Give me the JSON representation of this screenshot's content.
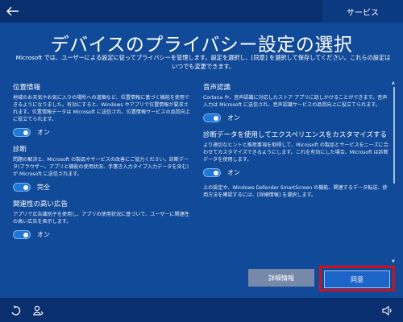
{
  "topbar": {
    "back_icon": "arrow-left-icon",
    "label": "サービス"
  },
  "title": "デバイスのプライバシー設定の選択",
  "intro": "Microsoft では、ユーザーによる設定に従ってプライバシーを管理します。設定を選択し、[同意] を選択して保存してください。これらの設定はいつでも変更できます。",
  "left": [
    {
      "title": "位置情報",
      "desc": "地域のお天気やお気に入りの場所への道順など、位置情報に基づく機能を使用できるようになりました。有効にすると、Windows やアプリで位置情報が要求されます。位置情報データは Microsoft に送信され、位置情報サービスの品質向上に役立てられます。",
      "toggle": "オン"
    },
    {
      "title": "診断",
      "desc": "問題の解決と、Microsoft の製品やサービスの改善にご協力ください。診断データ(ブラウザー、アプリと機能の使用状況、手書き入力タイプ入力データを含む)が Microsoft に送信されます。",
      "toggle": "完全"
    },
    {
      "title": "関連性の高い広告",
      "desc": "アプリで広告識別子を使用し、アプリの使用状況に基づいて、ユーザーに関連性の高い広告を表示します。",
      "toggle": "オン"
    }
  ],
  "right": [
    {
      "title": "音声認識",
      "desc": "Cortana や、音声認識に対応したストア アプリに話しかけることができます。音声入力は Microsoft に送信され、音声認識サービスの品質向上に役立てられます。",
      "toggle": "オン"
    },
    {
      "title": "診断データを使用してエクスペリエンスをカスタマイズする",
      "desc": "より適切なヒントと推奨事項を取得して、Microsoft の製品とサービスをニーズに合わせてカスタマイズできるようにします。これを有効にした場合、Microsoft は診断データを使用します。",
      "toggle": "オン"
    }
  ],
  "footer_note": "上の設定や、Windows Defender SmartScreen の機能、関連するデータ転送、使用方法を確認するには、[詳細情報] を選択します。",
  "buttons": {
    "details": "詳細情報",
    "agree": "同意"
  },
  "bottombar": {
    "left_icons": [
      "accessibility-icon",
      "user-account-icon"
    ],
    "right_icon": "volume-icon"
  },
  "colors": {
    "panel": "#114a98",
    "topbar": "#0a2f6f",
    "toggle_on": "#1e78d8",
    "highlight": "#d0101a"
  }
}
